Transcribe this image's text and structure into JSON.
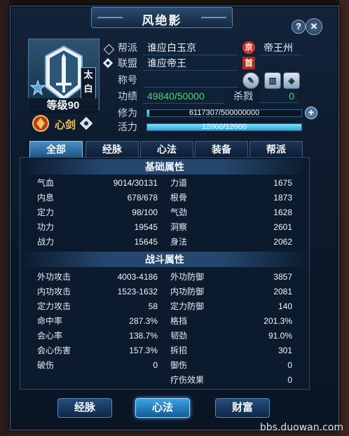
{
  "window": {
    "title": "风绝影"
  },
  "profile": {
    "level": "等级90",
    "school": "心剑",
    "avatar_tag": "太白"
  },
  "info": {
    "guild_label": "帮派",
    "guild_value": "谁应白玉京",
    "alliance_label": "联盟",
    "alliance_value": "谁应帝王",
    "city_badge": "京",
    "city_value": "帝王州",
    "leader_badge": "首",
    "title_label": "称号",
    "merit_label": "功绩",
    "merit_value": "49840/50000",
    "kill_label": "杀戮",
    "kill_value": "0",
    "cultivation_label": "修为",
    "cultivation_value": "6117307/500000000",
    "cultivation_fraction": 0.0122,
    "vigor_label": "活力",
    "vigor_value": "12000/12000",
    "vigor_fraction": 1.0
  },
  "tabs": [
    "全部",
    "经脉",
    "心法",
    "装备",
    "帮派"
  ],
  "basic": {
    "title": "基础属性",
    "left": [
      {
        "k": "气血",
        "v": "9014/30131"
      },
      {
        "k": "内息",
        "v": "678/678"
      },
      {
        "k": "定力",
        "v": "98/100"
      },
      {
        "k": "功力",
        "v": "19545"
      },
      {
        "k": "战力",
        "v": "15645"
      }
    ],
    "right": [
      {
        "k": "力道",
        "v": "1675"
      },
      {
        "k": "根骨",
        "v": "1873"
      },
      {
        "k": "气劲",
        "v": "1628"
      },
      {
        "k": "洞察",
        "v": "2601"
      },
      {
        "k": "身法",
        "v": "2062"
      }
    ]
  },
  "combat": {
    "title": "战斗属性",
    "left": [
      {
        "k": "外功攻击",
        "v": "4003-4186"
      },
      {
        "k": "内功攻击",
        "v": "1523-1632"
      },
      {
        "k": "定力攻击",
        "v": "58"
      },
      {
        "k": "命中率",
        "v": "287.3%"
      },
      {
        "k": "会心率",
        "v": "138.7%"
      },
      {
        "k": "会心伤害",
        "v": "157.3%"
      },
      {
        "k": "破伤",
        "v": "0"
      }
    ],
    "right": [
      {
        "k": "外功防御",
        "v": "3857"
      },
      {
        "k": "内功防御",
        "v": "2081"
      },
      {
        "k": "定力防御",
        "v": "140"
      },
      {
        "k": "格挡",
        "v": "201.3%"
      },
      {
        "k": "韧劲",
        "v": "91.0%"
      },
      {
        "k": "拆招",
        "v": "301"
      },
      {
        "k": "御伤",
        "v": "0"
      },
      {
        "k": "疗伤效果",
        "v": "0"
      }
    ]
  },
  "bottom_buttons": [
    "经脉",
    "心法",
    "财富"
  ],
  "watermark": "bbs.duowan.com",
  "colors": {
    "accent": "#3ba3e4",
    "merit": "#4bd56b",
    "school": "#f3c84a"
  }
}
